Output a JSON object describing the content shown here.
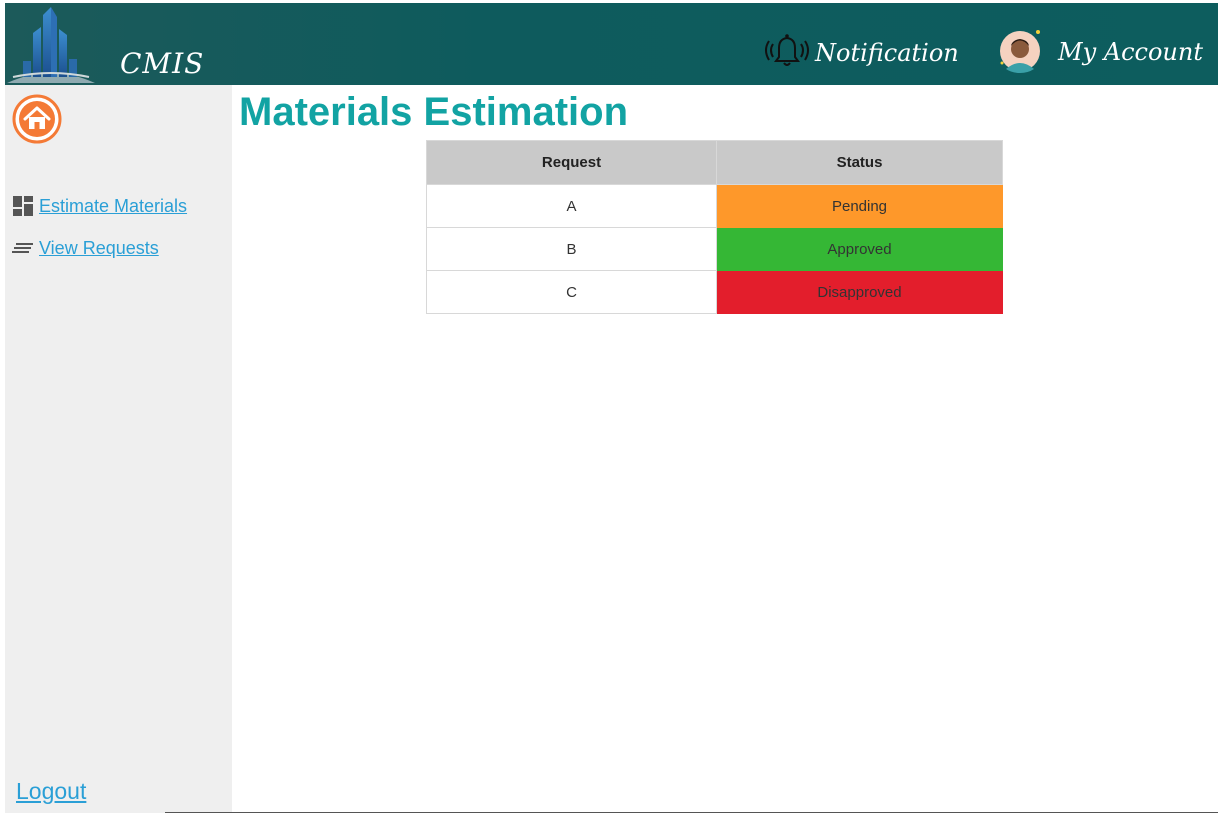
{
  "header": {
    "brand": "CMIS",
    "notification_label": "Notification",
    "account_label": "My Account"
  },
  "sidebar": {
    "items": [
      {
        "label": "Estimate Materials",
        "icon": "dashboard-icon"
      },
      {
        "label": "View Requests",
        "icon": "list-icon"
      }
    ],
    "logout_label": "Logout"
  },
  "main": {
    "title": "Materials Estimation",
    "table": {
      "headers": [
        "Request",
        "Status"
      ],
      "rows": [
        {
          "request": "A",
          "status": "Pending",
          "color": "#fe982a"
        },
        {
          "request": "B",
          "status": "Approved",
          "color": "#35b735"
        },
        {
          "request": "C",
          "status": "Disapproved",
          "color": "#e31e2c"
        }
      ]
    }
  },
  "colors": {
    "header_bg": "#0e5b5d",
    "accent": "#12a3a3",
    "link": "#2a9fd6",
    "home_icon": "#f47a36"
  }
}
